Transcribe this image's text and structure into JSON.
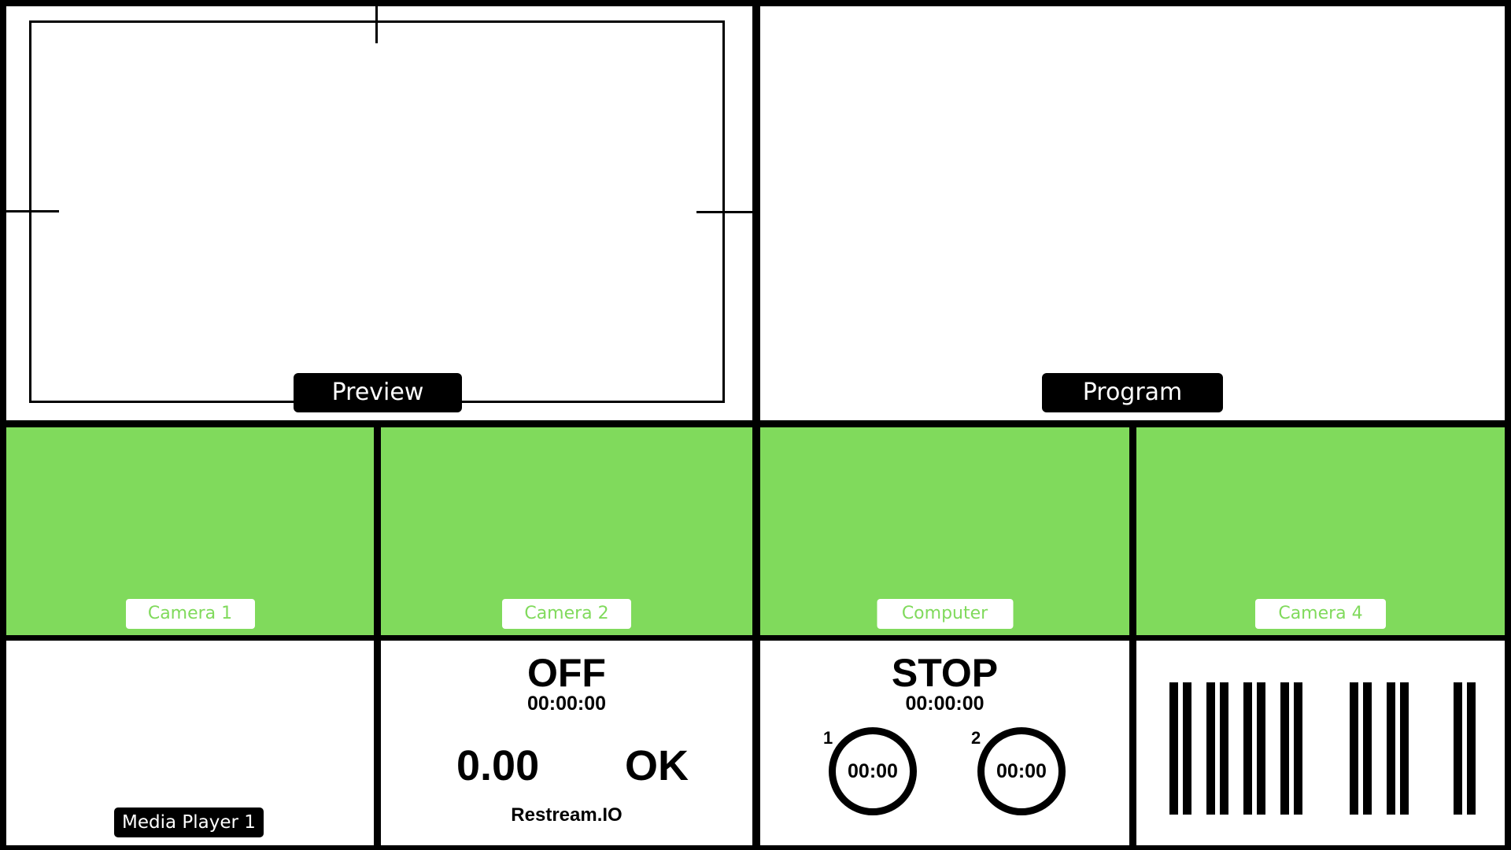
{
  "preview": {
    "label": "Preview"
  },
  "program": {
    "label": "Program"
  },
  "cameras": [
    {
      "label": "Camera 1"
    },
    {
      "label": "Camera 2"
    },
    {
      "label": "Computer"
    },
    {
      "label": "Camera 4"
    }
  ],
  "media_player": {
    "label": "Media Player 1"
  },
  "stream": {
    "status": "OFF",
    "time": "00:00:00",
    "value": "0.00",
    "health": "OK",
    "service": "Restream.IO"
  },
  "recording": {
    "status": "STOP",
    "time": "00:00:00",
    "timers": [
      {
        "number": "1",
        "time": "00:00"
      },
      {
        "number": "2",
        "time": "00:00"
      }
    ]
  },
  "audio_meter": {
    "icon": "audio-level-bars-icon"
  },
  "colors": {
    "camera_green": "#80DA5C",
    "border": "#000000"
  }
}
